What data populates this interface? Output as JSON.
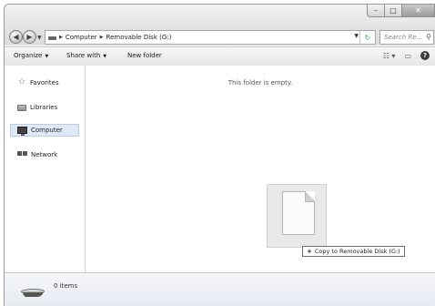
{
  "window": {
    "address": {
      "crumb1": "Computer",
      "crumb2": "Removable Disk (G:)"
    },
    "search_placeholder": "Search Re..."
  },
  "toolbar": {
    "organize": "Organize",
    "share_with": "Share with",
    "new_folder": "New folder"
  },
  "sidebar": {
    "items": [
      {
        "label": "Favorites",
        "icon": "star-icon"
      },
      {
        "label": "Libraries",
        "icon": "library-icon"
      },
      {
        "label": "Computer",
        "icon": "computer-icon",
        "selected": true
      },
      {
        "label": "Network",
        "icon": "network-icon"
      }
    ]
  },
  "content": {
    "empty_message": "This folder is empty.",
    "drag_tooltip": "Copy to Removable Disk (G:)"
  },
  "details": {
    "item_count": "0 items"
  }
}
